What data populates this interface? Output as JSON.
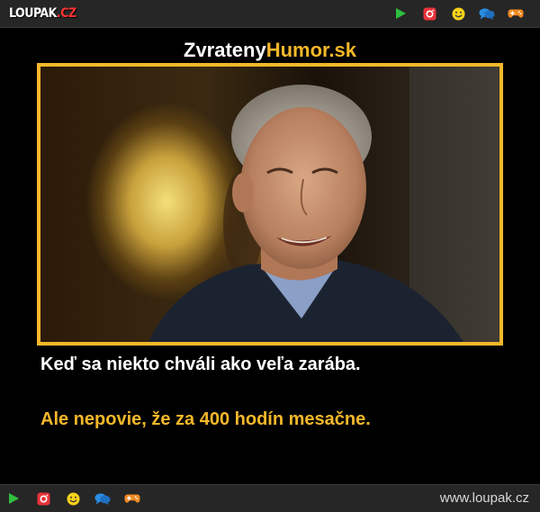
{
  "header": {
    "logo_text": "LOUPAK",
    "logo_tld": ".CZ",
    "icons": [
      "play-icon",
      "instagram-icon",
      "smiley-icon",
      "chat-icon",
      "gamepad-icon"
    ]
  },
  "post": {
    "site_name_part1": "Zvrateny",
    "site_name_part2": "Humor.sk",
    "caption_line1": "Keď sa niekto chváli ako veľa zarába.",
    "caption_line2": "Ale nepovie, že za 400 hodín mesačne."
  },
  "footer": {
    "url": "www.loupak.cz",
    "icons": [
      "play-icon",
      "instagram-icon",
      "smiley-icon",
      "chat-icon",
      "gamepad-icon"
    ]
  },
  "colors": {
    "accent": "#f4b82a",
    "bar": "#262626",
    "play": "#2fbf3f",
    "instagram": "#e8333a",
    "smiley": "#f7d21a",
    "chat": "#2a8ce0",
    "gamepad": "#f08a24"
  }
}
